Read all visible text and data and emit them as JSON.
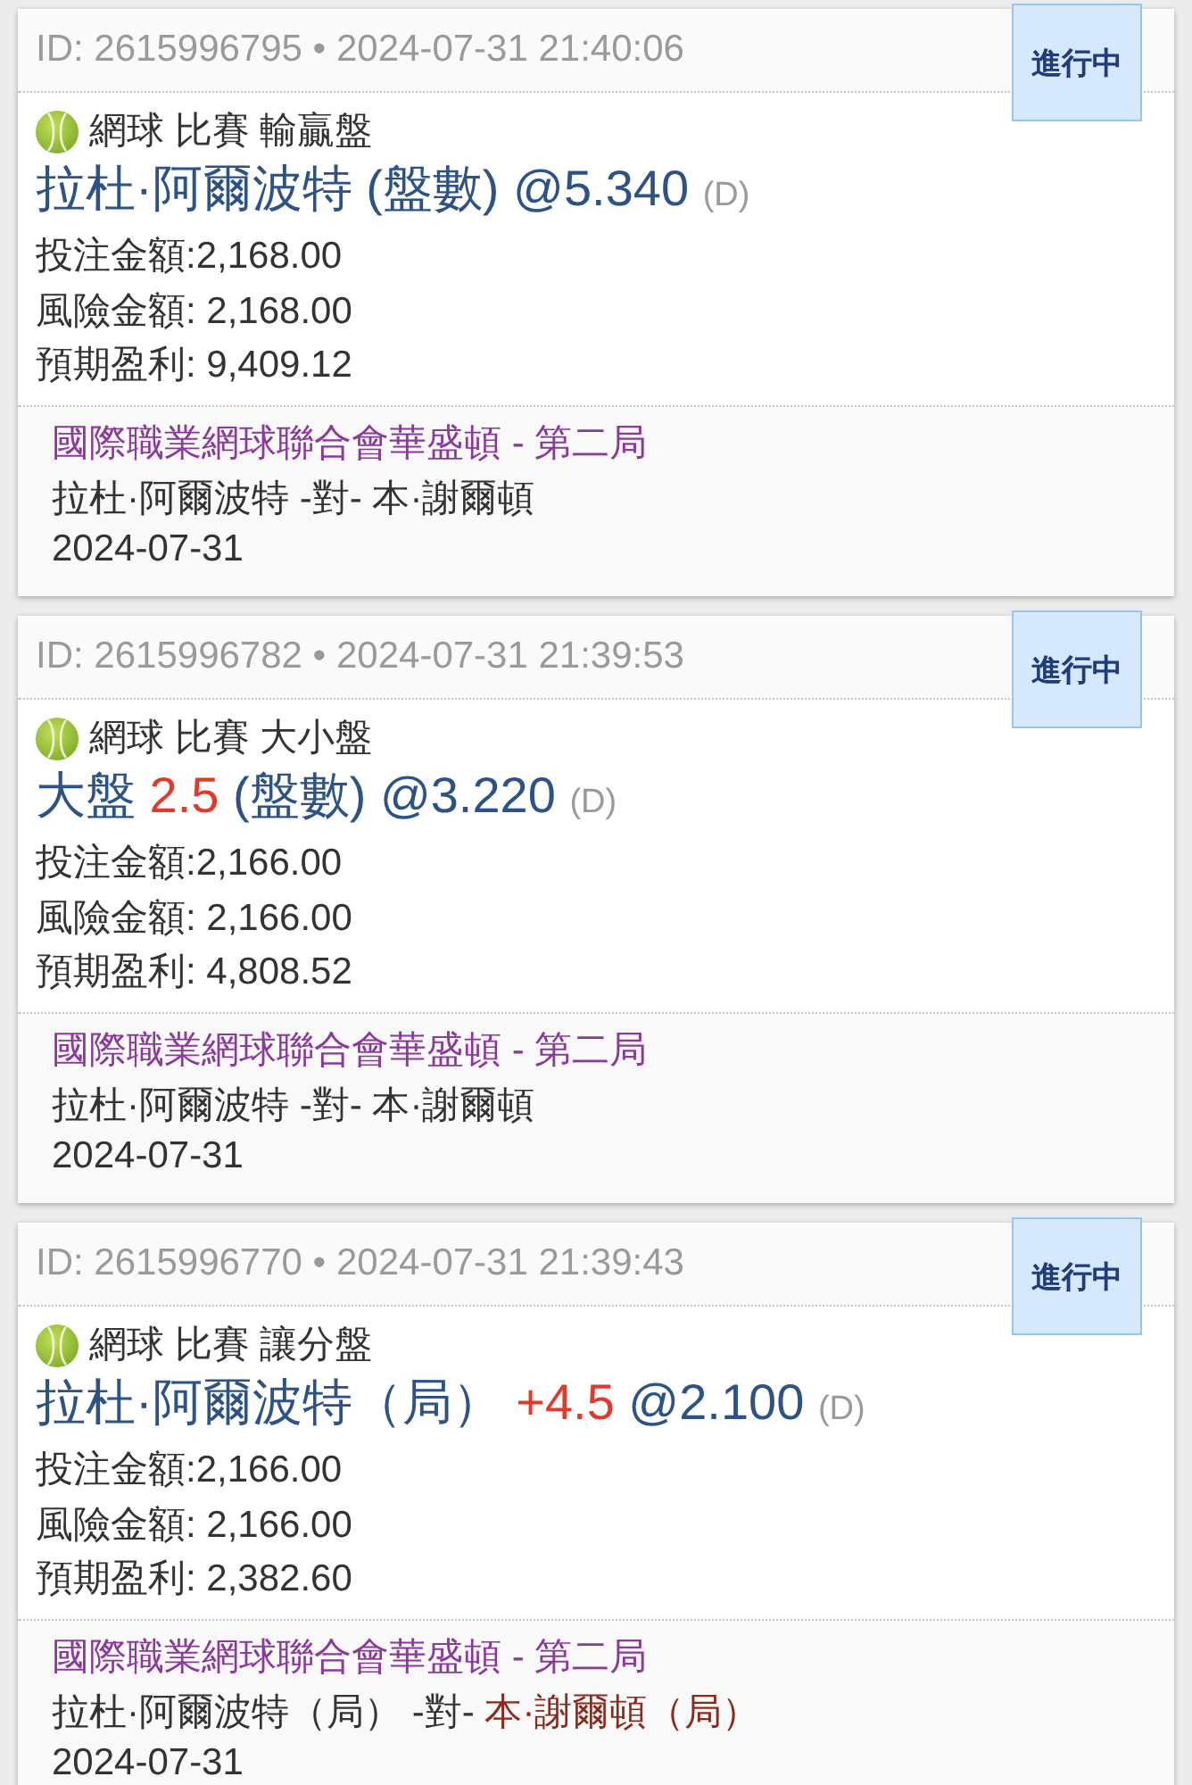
{
  "bets": [
    {
      "id_line": "ID: 2615996795 • 2024-07-31 21:40:06",
      "status": "進行中",
      "sport": "網球 比賽 輸贏盤",
      "selection": [
        {
          "kind": "plain",
          "text": "拉杜·阿爾波特 (盤數)"
        },
        {
          "kind": "odds",
          "text": "@5.340"
        },
        {
          "kind": "tag",
          "text": "(D)"
        }
      ],
      "amounts": [
        "投注金額:2,168.00",
        "風險金額: 2,168.00",
        "預期盈利: 9,409.12"
      ],
      "league": "國際職業網球聯合會華盛頓 - 第二局",
      "match": [
        {
          "text": "拉杜·阿爾波特",
          "highlighted": false
        },
        {
          "text": "-對-",
          "highlighted": false
        },
        {
          "text": "本·謝爾頓",
          "highlighted": false
        }
      ],
      "date": "2024-07-31"
    },
    {
      "id_line": "ID: 2615996782 • 2024-07-31 21:39:53",
      "status": "進行中",
      "sport": "網球 比賽 大小盤",
      "selection": [
        {
          "kind": "plain",
          "text": "大盤"
        },
        {
          "kind": "handicap",
          "text": "2.5"
        },
        {
          "kind": "plain",
          "text": "(盤數)"
        },
        {
          "kind": "odds",
          "text": "@3.220"
        },
        {
          "kind": "tag",
          "text": "(D)"
        }
      ],
      "amounts": [
        "投注金額:2,166.00",
        "風險金額: 2,166.00",
        "預期盈利: 4,808.52"
      ],
      "league": "國際職業網球聯合會華盛頓 - 第二局",
      "match": [
        {
          "text": "拉杜·阿爾波特",
          "highlighted": false
        },
        {
          "text": "-對-",
          "highlighted": false
        },
        {
          "text": "本·謝爾頓",
          "highlighted": false
        }
      ],
      "date": "2024-07-31"
    },
    {
      "id_line": "ID: 2615996770 • 2024-07-31 21:39:43",
      "status": "進行中",
      "sport": "網球 比賽 讓分盤",
      "selection": [
        {
          "kind": "plain",
          "text": "拉杜·阿爾波特（局）"
        },
        {
          "kind": "handicap",
          "text": "+4.5"
        },
        {
          "kind": "odds",
          "text": "@2.100"
        },
        {
          "kind": "tag",
          "text": "(D)"
        }
      ],
      "amounts": [
        "投注金額:2,166.00",
        "風險金額: 2,166.00",
        "預期盈利: 2,382.60"
      ],
      "league": "國際職業網球聯合會華盛頓 - 第二局",
      "match": [
        {
          "text": "拉杜·阿爾波特（局）",
          "highlighted": false
        },
        {
          "text": "-對-",
          "highlighted": false
        },
        {
          "text": "本·謝爾頓（局）",
          "highlighted": true
        }
      ],
      "date": "2024-07-31"
    }
  ]
}
